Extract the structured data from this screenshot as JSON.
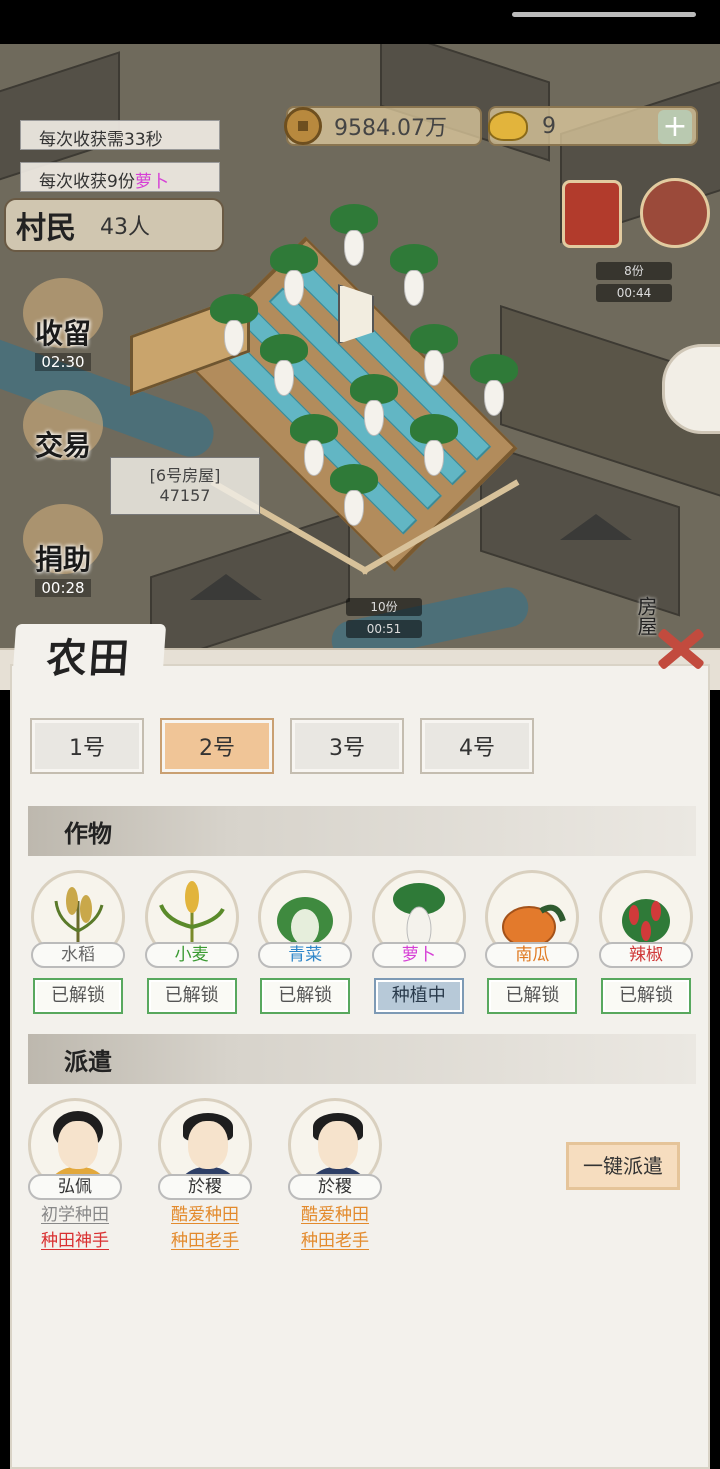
{
  "hud": {
    "coins": "9584.07万",
    "gold": "9",
    "plus": "+",
    "harvest_time": "每次收获需33秒",
    "harvest_amount_prefix": "每次收获9份",
    "harvest_amount_crop": "萝卜",
    "villagers_label": "村民",
    "villagers_count": "43人"
  },
  "side_buttons": [
    {
      "label": "收留",
      "time": "02:30"
    },
    {
      "label": "交易",
      "time": ""
    },
    {
      "label": "捐助",
      "time": "00:28"
    }
  ],
  "map": {
    "house_tag_title": "[6号房屋]",
    "house_tag_value": "47157",
    "timer_a_amount": "8份",
    "timer_a_time": "00:44",
    "timer_b_amount": "10份",
    "timer_b_time": "00:51",
    "right_label": "房屋"
  },
  "panel": {
    "title": "农田",
    "tabs": [
      "1号",
      "2号",
      "3号",
      "4号"
    ],
    "active_tab": "2号",
    "crops_section": "作物",
    "dispatch_section": "派遣",
    "crops": [
      {
        "name": "水稻",
        "state": "已解锁",
        "name_color": "#666666",
        "icon": "rice-icon"
      },
      {
        "name": "小麦",
        "state": "已解锁",
        "name_color": "#3a9a32",
        "icon": "wheat-icon"
      },
      {
        "name": "青菜",
        "state": "已解锁",
        "name_color": "#2f86c9",
        "icon": "greens-icon"
      },
      {
        "name": "萝卜",
        "state": "种植中",
        "name_color": "#d63fd6",
        "icon": "radish-icon"
      },
      {
        "name": "南瓜",
        "state": "已解锁",
        "name_color": "#e07a22",
        "icon": "pumpkin-icon"
      },
      {
        "name": "辣椒",
        "state": "已解锁",
        "name_color": "#d03a3a",
        "icon": "pepper-icon"
      }
    ],
    "workers": [
      {
        "name": "弘佩",
        "trait1": "初学种田",
        "trait2": "种田神手",
        "trait1_color": "#888888",
        "trait2_color": "#d93030"
      },
      {
        "name": "於稷",
        "trait1": "酷爱种田",
        "trait2": "种田老手",
        "trait1_color": "#e38a2c",
        "trait2_color": "#e38a2c"
      },
      {
        "name": "於稷",
        "trait1": "酷爱种田",
        "trait2": "种田老手",
        "trait1_color": "#e38a2c",
        "trait2_color": "#e38a2c"
      }
    ],
    "dispatch_all": "一键派遣"
  }
}
